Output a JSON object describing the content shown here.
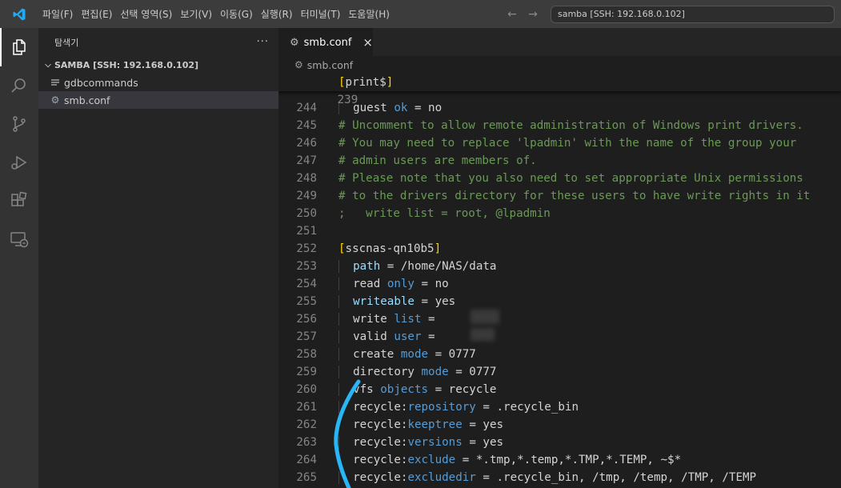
{
  "titlebar": {
    "menu": [
      "파일(F)",
      "편집(E)",
      "선택 영역(S)",
      "보기(V)",
      "이동(G)",
      "실행(R)",
      "터미널(T)",
      "도움말(H)"
    ],
    "command_center": "samba [SSH: 192.168.0.102]"
  },
  "activitybar": {
    "icons": [
      "explorer-icon",
      "search-icon",
      "source-control-icon",
      "run-debug-icon",
      "extensions-icon",
      "remote-explorer-icon"
    ]
  },
  "sidebar": {
    "title": "탐색기",
    "more": "···",
    "folder": "SAMBA [SSH: 192.168.0.102]",
    "files": [
      {
        "name": "gdbcommands",
        "icon": "file-lines-icon",
        "selected": false
      },
      {
        "name": "smb.conf",
        "icon": "gear-icon",
        "selected": true
      }
    ]
  },
  "editor": {
    "tab": {
      "label": "smb.conf",
      "close": "×"
    },
    "breadcrumb": "smb.conf",
    "sticky_line": {
      "num": "239",
      "open": "[",
      "text": "print$",
      "close": "]"
    },
    "lines": [
      {
        "num": "244",
        "indent": 1,
        "tokens": [
          {
            "t": "guest ",
            "c": "txt"
          },
          {
            "t": "ok",
            "c": "kw"
          },
          {
            "t": " = no",
            "c": "txt"
          }
        ]
      },
      {
        "num": "245",
        "indent": 0,
        "tokens": [
          {
            "t": "# Uncomment to allow remote administration of Windows print drivers.",
            "c": "com"
          }
        ]
      },
      {
        "num": "246",
        "indent": 0,
        "tokens": [
          {
            "t": "# You may need to replace 'lpadmin' with the name of the group your",
            "c": "com"
          }
        ]
      },
      {
        "num": "247",
        "indent": 0,
        "tokens": [
          {
            "t": "# admin users are members of.",
            "c": "com"
          }
        ]
      },
      {
        "num": "248",
        "indent": 0,
        "tokens": [
          {
            "t": "# Please note that you also need to set appropriate Unix permissions",
            "c": "com"
          }
        ]
      },
      {
        "num": "249",
        "indent": 0,
        "tokens": [
          {
            "t": "# to the drivers directory for these users to have write rights in it",
            "c": "com"
          }
        ]
      },
      {
        "num": "250",
        "indent": 0,
        "tokens": [
          {
            "t": ";   write list = root, @lpadmin",
            "c": "com"
          }
        ]
      },
      {
        "num": "251",
        "indent": 0,
        "tokens": []
      },
      {
        "num": "252",
        "indent": 0,
        "tokens": [
          {
            "t": "[",
            "c": "br"
          },
          {
            "t": "sscnas-qn10b5",
            "c": "txt"
          },
          {
            "t": "]",
            "c": "br"
          }
        ]
      },
      {
        "num": "253",
        "indent": 1,
        "tokens": [
          {
            "t": "path",
            "c": "key"
          },
          {
            "t": " = /home/NAS/data",
            "c": "txt"
          }
        ]
      },
      {
        "num": "254",
        "indent": 1,
        "tokens": [
          {
            "t": "read ",
            "c": "txt"
          },
          {
            "t": "only",
            "c": "kw"
          },
          {
            "t": " = no",
            "c": "txt"
          }
        ]
      },
      {
        "num": "255",
        "indent": 1,
        "tokens": [
          {
            "t": "writeable",
            "c": "key"
          },
          {
            "t": " = yes",
            "c": "txt"
          }
        ]
      },
      {
        "num": "256",
        "indent": 1,
        "tokens": [
          {
            "t": "write ",
            "c": "txt"
          },
          {
            "t": "list",
            "c": "kw"
          },
          {
            "t": " = ",
            "c": "txt"
          }
        ]
      },
      {
        "num": "257",
        "indent": 1,
        "tokens": [
          {
            "t": "valid ",
            "c": "txt"
          },
          {
            "t": "user",
            "c": "kw"
          },
          {
            "t": " = ",
            "c": "txt"
          }
        ]
      },
      {
        "num": "258",
        "indent": 1,
        "tokens": [
          {
            "t": "create ",
            "c": "txt"
          },
          {
            "t": "mode",
            "c": "kw"
          },
          {
            "t": " = 0777",
            "c": "txt"
          }
        ]
      },
      {
        "num": "259",
        "indent": 1,
        "tokens": [
          {
            "t": "directory ",
            "c": "txt"
          },
          {
            "t": "mode",
            "c": "kw"
          },
          {
            "t": " = 0777",
            "c": "txt"
          }
        ]
      },
      {
        "num": "260",
        "indent": 1,
        "tokens": [
          {
            "t": "vfs ",
            "c": "txt"
          },
          {
            "t": "objects",
            "c": "kw"
          },
          {
            "t": " = recycle",
            "c": "txt"
          }
        ]
      },
      {
        "num": "261",
        "indent": 1,
        "tokens": [
          {
            "t": "recycle:",
            "c": "txt"
          },
          {
            "t": "repository",
            "c": "kw"
          },
          {
            "t": " = .recycle_bin",
            "c": "txt"
          }
        ]
      },
      {
        "num": "262",
        "indent": 1,
        "tokens": [
          {
            "t": "recycle:",
            "c": "txt"
          },
          {
            "t": "keeptree",
            "c": "kw"
          },
          {
            "t": " = yes",
            "c": "txt"
          }
        ]
      },
      {
        "num": "263",
        "indent": 1,
        "tokens": [
          {
            "t": "recycle:",
            "c": "txt"
          },
          {
            "t": "versions",
            "c": "kw"
          },
          {
            "t": " = yes",
            "c": "txt"
          }
        ]
      },
      {
        "num": "264",
        "indent": 1,
        "tokens": [
          {
            "t": "recycle:",
            "c": "txt"
          },
          {
            "t": "exclude",
            "c": "kw"
          },
          {
            "t": " = *.tmp,*.temp,*.TMP,*.TEMP, ~$*",
            "c": "txt"
          }
        ]
      },
      {
        "num": "265",
        "indent": 1,
        "tokens": [
          {
            "t": "recycle:",
            "c": "txt"
          },
          {
            "t": "excludedir",
            "c": "kw"
          },
          {
            "t": " = .recycle_bin, /tmp, /temp, /TMP, /TEMP",
            "c": "txt"
          }
        ]
      }
    ]
  },
  "colors": {
    "comment": "#6a9955",
    "keyword": "#569cd6",
    "variable": "#9cdcfe",
    "bracket": "#ffd700",
    "annotation": "#29b6f6"
  }
}
